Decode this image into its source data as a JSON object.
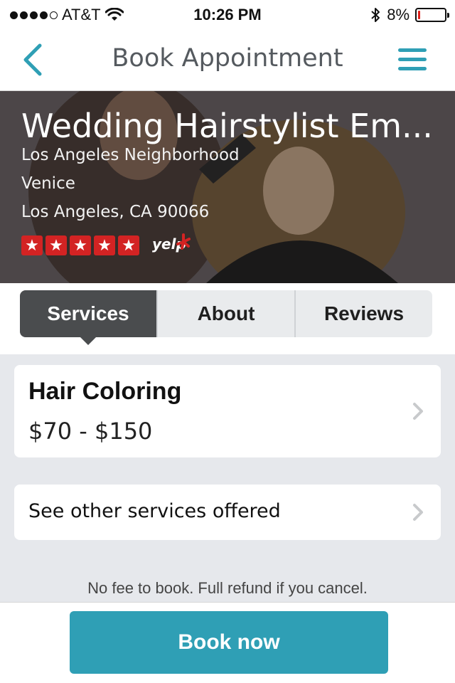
{
  "status_bar": {
    "carrier": "AT&T",
    "time": "10:26 PM",
    "battery_percent": "8%",
    "battery_level": 0.08,
    "signal_icon": "signal-dots-icon",
    "wifi_icon": "wifi-icon",
    "bluetooth_icon": "bluetooth-icon"
  },
  "nav": {
    "title": "Book Appointment",
    "back_icon": "chevron-left-icon",
    "menu_icon": "hamburger-menu-icon",
    "accent_color": "#2f9fb5"
  },
  "business": {
    "name": "Wedding Hairstylist Em...",
    "neighborhood": "Los Angeles Neighborhood",
    "area": "Venice",
    "city_state_zip": "Los Angeles, CA 90066",
    "rating_stars": 5,
    "rating_max": 5,
    "rating_source_logo": "yelp",
    "star_color": "#d32323"
  },
  "tabs": [
    {
      "label": "Services",
      "active": true
    },
    {
      "label": "About",
      "active": false
    },
    {
      "label": "Reviews",
      "active": false
    }
  ],
  "service": {
    "name": "Hair Coloring",
    "price": "$70 - $150"
  },
  "other_services": {
    "label": "See other services offered"
  },
  "footer": {
    "note": "No fee to book. Full refund if you cancel.",
    "book_label": "Book now",
    "button_color": "#2f9fb5"
  }
}
